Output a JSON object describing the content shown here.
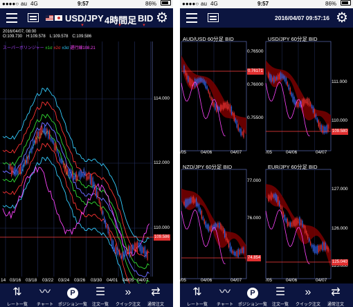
{
  "status_left": {
    "carrier": "au",
    "network": "4G",
    "time": "9:57",
    "battery": "86%"
  },
  "status_right": {
    "carrier": "au",
    "network": "4G",
    "time": "9:57",
    "battery": "86%"
  },
  "left": {
    "pair": "USD/JPY",
    "timeframe": "4時間足",
    "side": "BID",
    "ohlc_line1": "2016/04/07, 08:00",
    "ohlc_line2": "O:109.730　H:109.578　L:109.578　C:109.586",
    "legend": [
      {
        "text": "スーパーボリンジャー",
        "color": "#aa44ff"
      },
      {
        "text": "±1σ",
        "color": "#33dd33"
      },
      {
        "text": "±2σ",
        "color": "#ff3333"
      },
      {
        "text": "±3σ",
        "color": "#33ccff"
      },
      {
        "text": "遅行線108.21",
        "color": "#ff44ff"
      }
    ],
    "y_ticks": [
      "114.000",
      "112.000",
      "110.000"
    ],
    "x_ticks": [
      "14",
      "03/16",
      "03/18",
      "03/22",
      "03/24",
      "03/26",
      "03/30",
      "04/01",
      "04/05",
      "04/07"
    ],
    "price_tag": "109.586"
  },
  "right": {
    "datetime": "2016/04/07 09:57:16",
    "panels": [
      {
        "title": "AUD/USD  60分足  BID",
        "y_ticks": [
          "0.76500",
          "0.76000",
          "0.75500"
        ],
        "x_ticks": [
          "/05",
          "04/06",
          "04/07"
        ],
        "price_tag": "0.76171"
      },
      {
        "title": "USD/JPY  60分足  BID",
        "y_ticks": [
          "111.000",
          "110.000"
        ],
        "x_ticks": [
          "/05",
          "04/06",
          "04/07"
        ],
        "price_tag": "109.580"
      },
      {
        "title": "NZD/JPY  60分足  BID",
        "y_ticks": [
          "77.000",
          "76.000"
        ],
        "x_ticks": [
          "/05",
          "04/06",
          "04/07"
        ],
        "price_tag": "74.854"
      },
      {
        "title": "EUR/JPY  60分足  BID",
        "y_ticks": [
          "127.000",
          "126.000",
          "125.000"
        ],
        "x_ticks": [
          "/05",
          "04/06",
          "04/07"
        ],
        "price_tag": "125.040"
      }
    ]
  },
  "tabs": [
    {
      "label": "レート一覧",
      "icon": "rate-list-icon"
    },
    {
      "label": "チャート",
      "icon": "chart-icon"
    },
    {
      "label": "ポジション一覧",
      "icon": "position-icon"
    },
    {
      "label": "注文一覧",
      "icon": "order-list-icon"
    },
    {
      "label": "クイック注文",
      "icon": "quick-order-icon"
    },
    {
      "label": "通常注文",
      "icon": "normal-order-icon"
    }
  ],
  "colors": {
    "navbar": "#0c1540",
    "candle_up": "#e03030",
    "candle_down": "#3060e0",
    "cloud": "#7a0000",
    "price_line": "#ff4040"
  }
}
